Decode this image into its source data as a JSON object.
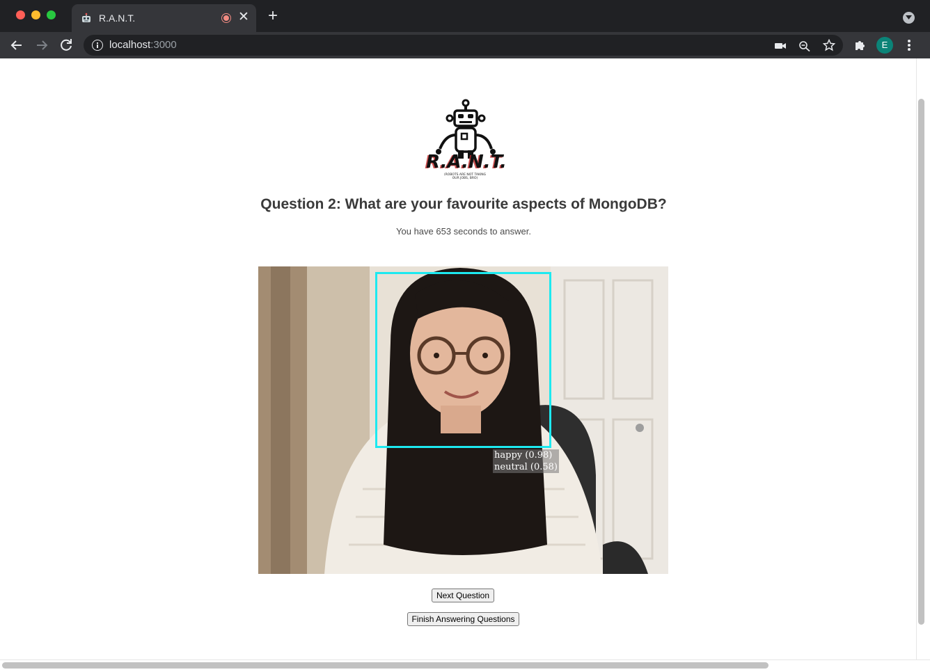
{
  "browser": {
    "tab": {
      "title": "R.A.N.T.",
      "favicon": "robot-icon"
    },
    "address": {
      "host": "localhost",
      "port": ":3000"
    },
    "profile_initial": "E",
    "colors": {
      "chrome_dark": "#202124",
      "chrome_toolbar": "#35363a",
      "profile": "#0b8478"
    }
  },
  "logo": {
    "wordmark": "R.A.N.T.",
    "tagline_line1": "(ROBOTS ARE NOT TAKING",
    "tagline_line2": "OUR JOBS, BRO)"
  },
  "question": {
    "text": "Question 2: What are your favourite aspects of MongoDB?",
    "timer_text": "You have 653 seconds to answer."
  },
  "detection": {
    "labels": [
      "happy (0.98)",
      "neutral (0.58)"
    ],
    "box_color": "#1de9f0"
  },
  "buttons": {
    "next_label": "Next Question",
    "finish_label": "Finish Answering Questions"
  }
}
